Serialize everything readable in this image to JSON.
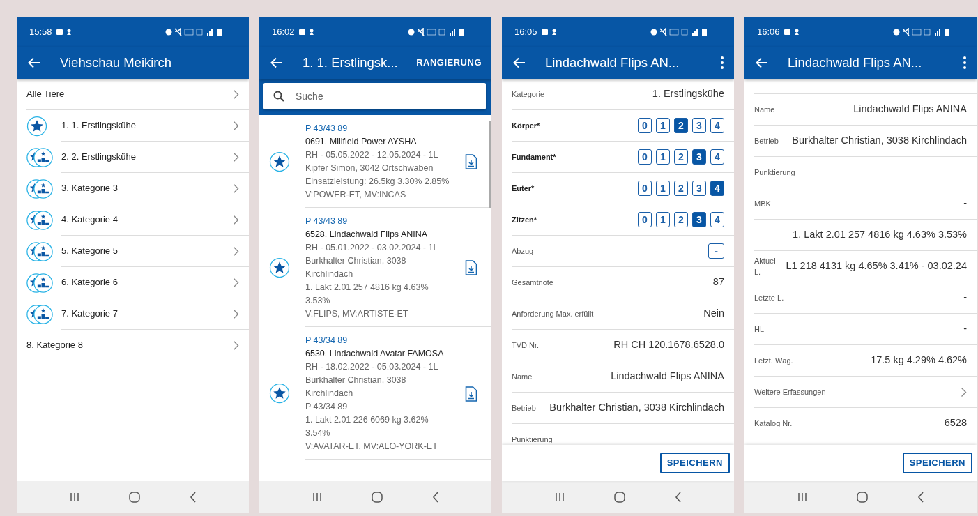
{
  "screens": [
    {
      "kind": "categories",
      "time": "15:58",
      "title": "Viehschau Meikirch",
      "items": [
        {
          "label": "Alle Tiere",
          "kind": "plain"
        },
        {
          "label": "1. 1. Erstlingskühe",
          "kind": "star"
        },
        {
          "label": "2. 2. Erstlingskühe",
          "kind": "ranking"
        },
        {
          "label": "3. Kategorie 3",
          "kind": "ranking"
        },
        {
          "label": "4. Kategorie 4",
          "kind": "ranking"
        },
        {
          "label": "5. Kategorie 5",
          "kind": "ranking"
        },
        {
          "label": "6. Kategorie 6",
          "kind": "ranking"
        },
        {
          "label": "7. Kategorie 7",
          "kind": "ranking"
        },
        {
          "label": "8. Kategorie 8",
          "kind": "plain"
        }
      ]
    },
    {
      "kind": "animals",
      "time": "16:02",
      "title": "1. 1. Erstlingsk...",
      "action": "RANGIERUNG",
      "search": {
        "placeholder": "Suche"
      },
      "items": [
        {
          "code": "P 43/43 89",
          "name": "0691. Millfield Power AYSHA",
          "lines": [
            "RH - 05.05.2022 - 12.05.2024 - 1L",
            "Kipfer Simon, 3042 Ortschwaben",
            "Einsatzleistung: 26.5kg 3.30% 2.85%",
            "V:POWER-ET, MV:INCAS"
          ]
        },
        {
          "code": "P 43/43 89",
          "name": "6528. Lindachwald Flips ANINA",
          "lines": [
            "RH - 05.01.2022 - 03.02.2024 - 1L",
            "Burkhalter Christian, 3038 Kirchlindach",
            "1. Lakt 2.01 257 4816 kg 4.63% 3.53%",
            "V:FLIPS, MV:ARTISTE-ET"
          ]
        },
        {
          "code": "P 43/34 89",
          "name": "6530. Lindachwald Avatar FAMOSA",
          "lines": [
            "RH - 18.02.2022 - 05.03.2024 - 1L",
            "Burkhalter Christian, 3038 Kirchlindach",
            "P 43/34 89",
            "1. Lakt 2.01 226 6069 kg 3.62% 3.54%",
            "V:AVATAR-ET, MV:ALO-YORK-ET"
          ]
        }
      ]
    },
    {
      "kind": "form",
      "time": "16:05",
      "title": "Lindachwald Flips AN...",
      "save": "SPEICHERN",
      "rows": [
        {
          "kind": "value",
          "label": "Kategorie",
          "value": "1. Erstlingskühe"
        },
        {
          "kind": "rating",
          "label": "Körper*",
          "options": [
            {
              "label": "0",
              "selected": false
            },
            {
              "label": "1",
              "selected": false
            },
            {
              "label": "2",
              "selected": true
            },
            {
              "label": "3",
              "selected": false
            },
            {
              "label": "4",
              "selected": false
            }
          ]
        },
        {
          "kind": "rating",
          "label": "Fundament*",
          "options": [
            {
              "label": "0",
              "selected": false
            },
            {
              "label": "1",
              "selected": false
            },
            {
              "label": "2",
              "selected": false
            },
            {
              "label": "3",
              "selected": true
            },
            {
              "label": "4",
              "selected": false
            }
          ]
        },
        {
          "kind": "rating",
          "label": "Euter*",
          "options": [
            {
              "label": "0",
              "selected": false
            },
            {
              "label": "1",
              "selected": false
            },
            {
              "label": "2",
              "selected": false
            },
            {
              "label": "3",
              "selected": false
            },
            {
              "label": "4",
              "selected": true
            }
          ]
        },
        {
          "kind": "rating",
          "label": "Zitzen*",
          "options": [
            {
              "label": "0",
              "selected": false
            },
            {
              "label": "1",
              "selected": false
            },
            {
              "label": "2",
              "selected": false
            },
            {
              "label": "3",
              "selected": true
            },
            {
              "label": "4",
              "selected": false
            }
          ]
        },
        {
          "kind": "action",
          "label": "Abzug",
          "button": "-"
        },
        {
          "kind": "value",
          "label": "Gesamtnote",
          "value": "87"
        },
        {
          "kind": "value",
          "label": "Anforderung Max. erfüllt",
          "value": "Nein"
        },
        {
          "kind": "value",
          "label": "TVD Nr.",
          "value": "RH CH 120.1678.6528.0"
        },
        {
          "kind": "value",
          "label": "Name",
          "value": "Lindachwald Flips ANINA"
        },
        {
          "kind": "value",
          "label": "Betrieb",
          "value": "Burkhalter Christian, 3038 Kirchlindach"
        },
        {
          "kind": "value",
          "label": "Punktierung"
        }
      ]
    },
    {
      "kind": "form",
      "time": "16:06",
      "title": "Lindachwald Flips AN...",
      "save": "SPEICHERN",
      "rows": [
        {
          "kind": "value",
          "label": "Name",
          "value": "Lindachwald Flips ANINA"
        },
        {
          "kind": "value",
          "label": "Betrieb",
          "value": "Burkhalter Christian, 3038 Kirchlindach"
        },
        {
          "kind": "value",
          "label": "Punktierung"
        },
        {
          "kind": "value",
          "label": "MBK",
          "value": "-"
        },
        {
          "kind": "value",
          "value": "1. Lakt 2.01 257 4816 kg 4.63% 3.53%"
        },
        {
          "kind": "value",
          "label": "Aktuel L.",
          "value": "L1 218 4131 kg 4.65% 3.41% - 03.02.24"
        },
        {
          "kind": "value",
          "label": "Letzte L.",
          "value": "-"
        },
        {
          "kind": "value",
          "label": "HL",
          "value": "-"
        },
        {
          "kind": "value",
          "label": "Letzt. Wäg.",
          "value": "17.5 kg 4.29% 4.62%"
        },
        {
          "kind": "link",
          "label": "Weitere Erfassungen"
        },
        {
          "kind": "value",
          "label": "Katalog Nr.",
          "value": "6528"
        }
      ]
    }
  ]
}
